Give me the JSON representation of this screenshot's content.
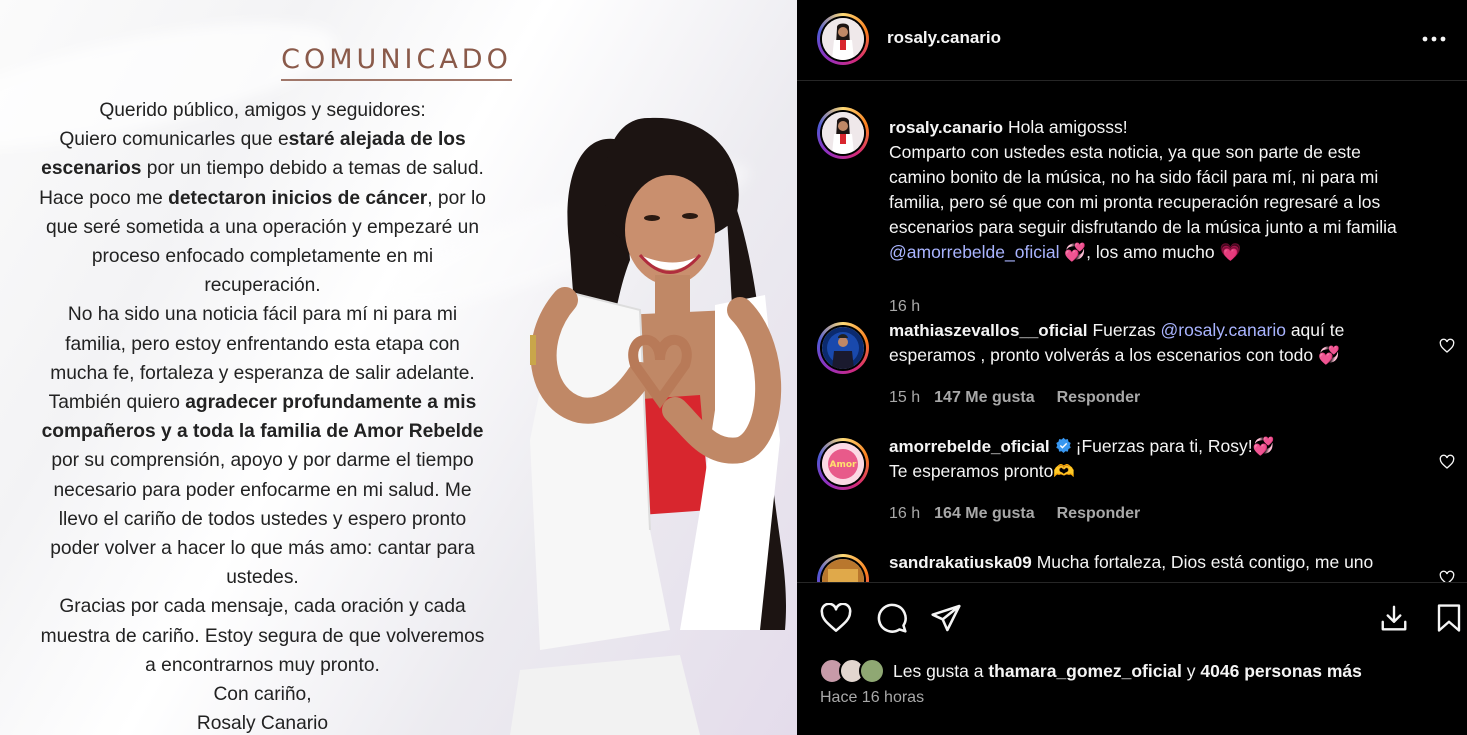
{
  "image": {
    "title": "COMUNICADO",
    "lines": [
      [
        {
          "t": "Querido público, amigos y seguidores:"
        }
      ],
      [
        {
          "t": "Quiero comunicarles que e"
        },
        {
          "t": "staré alejada de los",
          "b": true
        }
      ],
      [
        {
          "t": "escenarios",
          "b": true
        },
        {
          "t": " por un tiempo debido a temas de salud."
        }
      ],
      [
        {
          "t": "Hace poco me "
        },
        {
          "t": "detectaron inicios de cáncer",
          "b": true
        },
        {
          "t": ", por lo"
        }
      ],
      [
        {
          "t": "que seré sometida a una operación y empezaré un"
        }
      ],
      [
        {
          "t": "proceso enfocado completamente en mi"
        }
      ],
      [
        {
          "t": "recuperación."
        }
      ],
      [
        {
          "t": "No ha sido una noticia fácil para mí ni para mi"
        }
      ],
      [
        {
          "t": "familia, pero estoy enfrentando esta etapa con"
        }
      ],
      [
        {
          "t": "mucha fe, fortaleza y esperanza de salir adelante."
        }
      ],
      [
        {
          "t": "También quiero "
        },
        {
          "t": "agradecer profundamente a mis",
          "b": true
        }
      ],
      [
        {
          "t": "compañeros y a toda la familia de Amor Rebelde",
          "b": true
        }
      ],
      [
        {
          "t": "por su comprensión, apoyo y por darme el tiempo"
        }
      ],
      [
        {
          "t": "necesario para poder enfocarme en mi salud. Me"
        }
      ],
      [
        {
          "t": "llevo el cariño de todos ustedes y espero pronto"
        }
      ],
      [
        {
          "t": "poder volver a hacer lo que más amo: cantar para"
        }
      ],
      [
        {
          "t": "ustedes."
        }
      ],
      [
        {
          "t": "Gracias por cada mensaje, cada oración y cada"
        }
      ],
      [
        {
          "t": "muestra de cariño. Estoy segura de que volveremos"
        }
      ],
      [
        {
          "t": "a encontrarnos muy pronto."
        }
      ],
      [
        {
          "t": "Con cariño,"
        }
      ],
      [
        {
          "t": "Rosaly Canario"
        }
      ]
    ]
  },
  "header": {
    "username": "rosaly.canario",
    "more_icon": "more-horizontal-icon",
    "more_label": "•••"
  },
  "caption": {
    "username": "rosaly.canario",
    "text_lines": [
      "Hola amigosss!",
      "Comparto con ustedes esta noticia, ya que son parte de este",
      "camino bonito de la música, no ha sido fácil para mí, ni para mi",
      "familia, pero sé que con mi pronta recuperación regresaré a los",
      "escenarios para seguir disfrutando de la música junto a mi familia"
    ],
    "mention": "@amorrebelde_oficial",
    "tail": ", los amo mucho",
    "emoji_1": "💞",
    "emoji_2": "💗",
    "time": "16 h"
  },
  "comments": [
    {
      "username": "mathiaszevallos__oficial",
      "text_before": "Fuerzas",
      "mention": "@rosaly.canario",
      "text_after": "aquí te",
      "line2": "esperamos , pronto volverás a los escenarios con todo",
      "emoji": "💞",
      "time": "15 h",
      "likes": "147 Me gusta",
      "reply": "Responder"
    },
    {
      "username": "amorrebelde_oficial",
      "text": "¡Fuerzas para ti, Rosy!",
      "emoji": "💞",
      "line2": "Te esperamos pronto",
      "emoji2": "🫶",
      "time": "16 h",
      "likes": "164 Me gusta",
      "reply": "Responder"
    },
    {
      "username": "sandrakatiuska09",
      "text": "Mucha fortaleza, Dios está contigo, me uno"
    }
  ],
  "actions": {
    "like_icon": "heart-icon",
    "comment_icon": "comment-icon",
    "share_icon": "send-icon",
    "download_icon": "download-icon",
    "save_icon": "bookmark-icon"
  },
  "likes": {
    "prefix": "Les gusta a",
    "user": "thamara_gomez_oficial",
    "middle": "y",
    "others": "4046 personas más"
  },
  "posted": "Hace 16 horas",
  "colors": {
    "background": "#000000",
    "text": "#f5f5f5",
    "secondary": "#a8a8a8",
    "mention": "#a9b4ff",
    "title_brown": "#8a5a4a"
  }
}
